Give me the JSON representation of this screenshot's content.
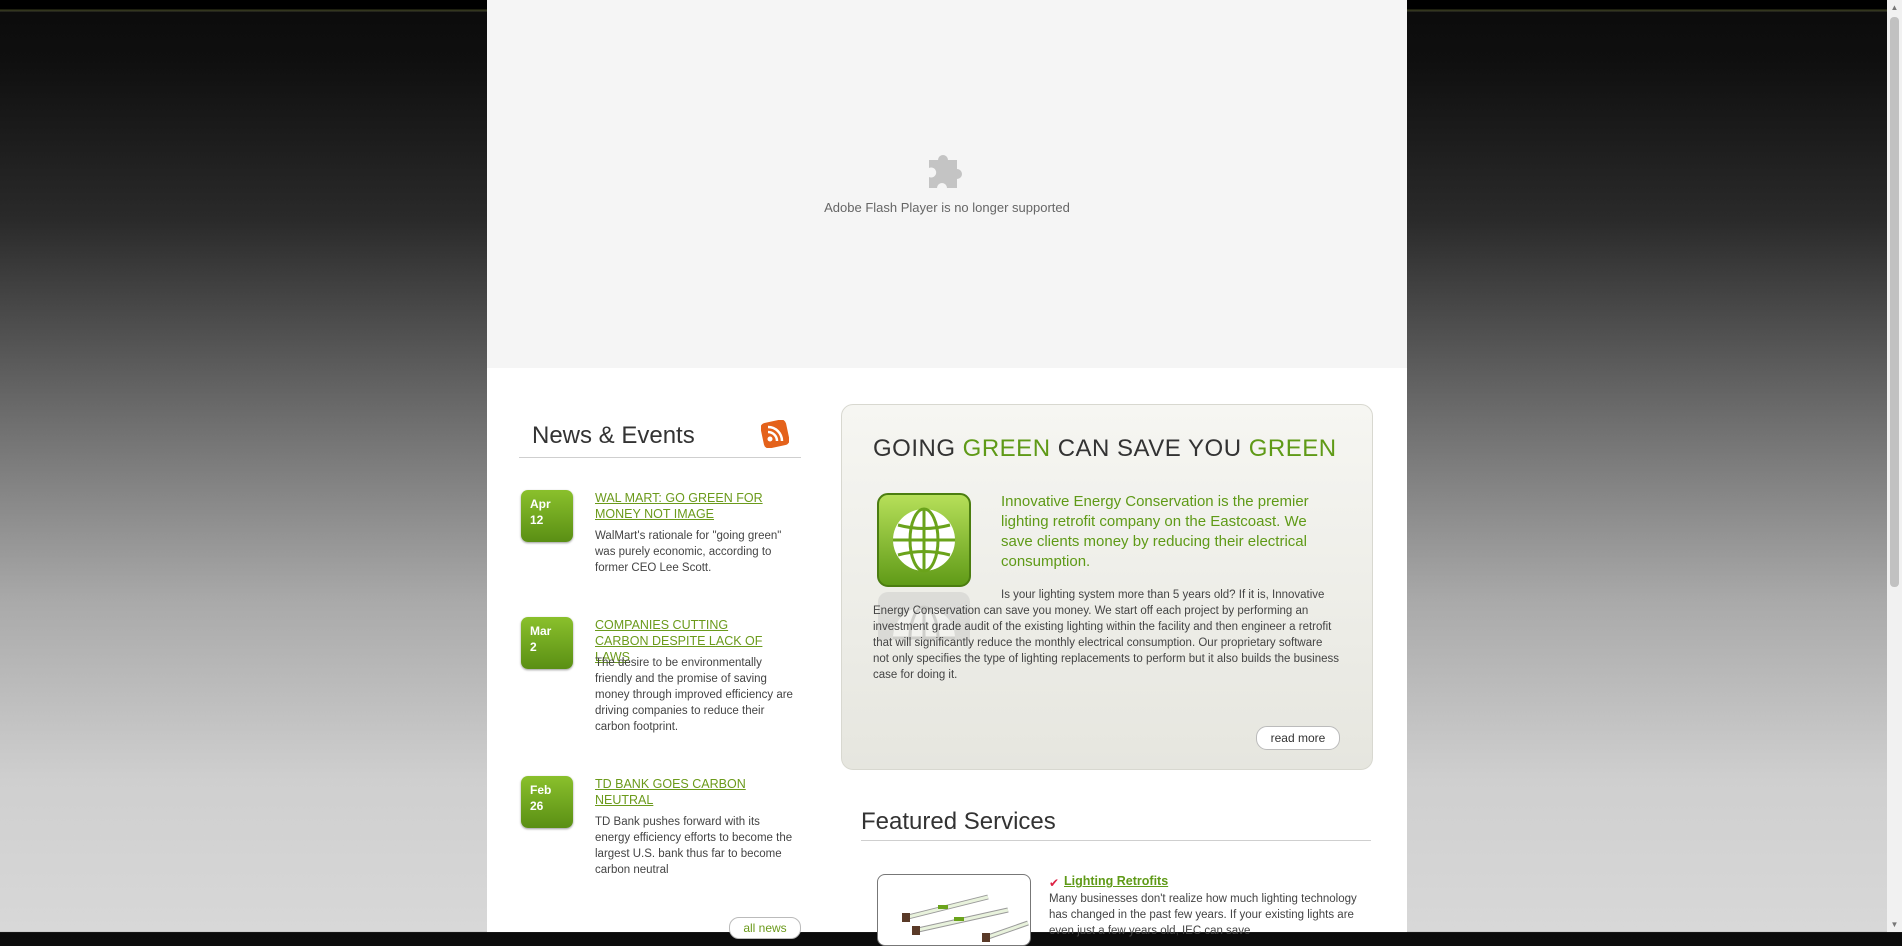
{
  "flash": {
    "message": "Adobe Flash Player is no longer supported",
    "icon": "puzzle-icon"
  },
  "news": {
    "title": "News & Events",
    "rss_icon": "rss-icon",
    "items": [
      {
        "month": "Apr",
        "day": "12",
        "title": "WAL MART: GO GREEN FOR MONEY NOT IMAGE",
        "desc": "WalMart's rationale for \"going green\" was purely economic, according to former CEO Lee Scott."
      },
      {
        "month": "Mar",
        "day": "2",
        "title": "COMPANIES CUTTING CARBON DESPITE LACK OF LAWS",
        "desc": "The desire to be environmentally friendly and the promise of saving money through improved efficiency are driving companies to reduce their carbon footprint."
      },
      {
        "month": "Feb",
        "day": "26",
        "title": "TD BANK GOES CARBON NEUTRAL",
        "desc": "TD Bank pushes forward with its energy efficiency efforts to become the largest U.S. bank thus far to become carbon neutral"
      }
    ],
    "all_news": "all news"
  },
  "intro": {
    "title_parts": [
      "GOING ",
      "GREEN",
      " CAN SAVE YOU ",
      "GREEN"
    ],
    "lead": "Innovative Energy Conservation is the premier lighting retrofit company on the Eastcoast. We save clients money by reducing their electrical consumption.",
    "body": "Is your lighting system more than 5 years old? If it is, Innovative Energy Conservation can save you money. We start off each project by performing an investment grade audit of the existing lighting within the facility and then engineer a retrofit that will significantly reduce the monthly electrical consumption. Our proprietary software not only specifies the type of lighting replacements to perform but it also builds the business case for doing it.",
    "read_more": "read more",
    "icon": "globe-icon"
  },
  "featured": {
    "title": "Featured Services",
    "service": {
      "title": "Lighting Retrofits",
      "desc": "Many businesses don't realize how much lighting technology has changed in the past few years. If your existing lights are even just a few years old, IEC can save"
    }
  },
  "colors": {
    "accent": "#5f9a17",
    "panel": "#eeeee8"
  }
}
